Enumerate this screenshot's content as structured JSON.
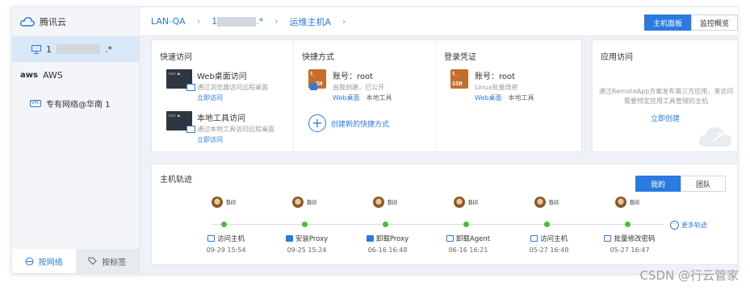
{
  "sidebar": {
    "brand": "腾讯云",
    "host_suffix": ".*",
    "host_prefix": "1",
    "aws_logo": "aws",
    "aws_label": "AWS",
    "vpc_badge": "VPC",
    "vpc_label": "专有网络@华南 1",
    "tabs": [
      {
        "label": "按网络",
        "active": true
      },
      {
        "label": "按标签",
        "active": false
      }
    ]
  },
  "breadcrumb": {
    "items": [
      "LAN-QA",
      "1",
      ".*",
      "运维主机A"
    ]
  },
  "view_buttons": [
    "主机面板",
    "监控概览"
  ],
  "quick_access": {
    "title": "快速访问",
    "items": [
      {
        "title": "Web桌面访问",
        "desc": "通过浏览器访问远程桌面",
        "link": "立即访问"
      },
      {
        "title": "本地工具访问",
        "desc": "通过本地工具访问远程桌面",
        "link": "立即访问"
      }
    ]
  },
  "shortcut": {
    "title": "快捷方式",
    "account": "账号：root",
    "desc": "由我创建，已公开",
    "link": "Web桌面",
    "plain": "本地工具",
    "create": "创建新的快捷方式",
    "icon_top": "$_",
    "icon_bottom": "SH"
  },
  "credential": {
    "title": "登录凭证",
    "account": "账号：root",
    "desc": "Linux批量改密",
    "link": "Web桌面",
    "plain": "本地工具",
    "icon_top": "$_",
    "icon_bottom": "SSH"
  },
  "app_access": {
    "title": "应用访问",
    "desc": "通过RemoteApp方案发布第三方应用，来访问需要特定应用工具管理的主机",
    "link": "立即创建"
  },
  "track": {
    "title": "主机轨迹",
    "segments": [
      "我的",
      "团队"
    ],
    "events": [
      {
        "user": "Bill",
        "action": "访问主机",
        "date": "09-29 15:54",
        "icon": "monitor-icon"
      },
      {
        "user": "Bill",
        "action": "安装Proxy",
        "date": "09-25 15:24",
        "icon": "proxy-icon"
      },
      {
        "user": "Bill",
        "action": "卸载Proxy",
        "date": "06-16 16:48",
        "icon": "proxy-icon"
      },
      {
        "user": "Bill",
        "action": "卸载Agent",
        "date": "06-16 16:21",
        "icon": "agent-icon"
      },
      {
        "user": "Bill",
        "action": "访问主机",
        "date": "05-27 16:48",
        "icon": "monitor-icon"
      },
      {
        "user": "Bill",
        "action": "批量修改密码",
        "date": "05-27 16:47",
        "icon": "monitor-icon"
      }
    ],
    "more": "更多轨迹"
  },
  "watermark": "CSDN @行云管家",
  "colors": {
    "accent": "#2a7ae2",
    "dot": "#4cbb3a",
    "ssh": "#c56d2a"
  }
}
